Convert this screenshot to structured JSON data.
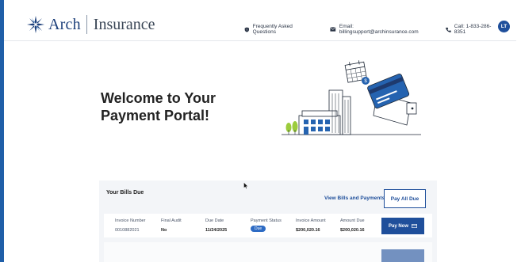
{
  "brand": {
    "name_left": "Arch",
    "name_right": "Insurance",
    "accent": "#1f4f9b"
  },
  "header": {
    "links": [
      {
        "icon": "question-shield-icon",
        "label": "Frequently Asked Questions"
      },
      {
        "icon": "mail-icon",
        "label": "Email: billingsupport@archinsurance.com"
      },
      {
        "icon": "phone-icon",
        "label": "Call: 1-833-286-8351"
      }
    ],
    "avatar_initials": "LT"
  },
  "welcome": {
    "line1": "Welcome to Your",
    "line2": "Payment Portal!"
  },
  "bills": {
    "title": "Your Bills Due",
    "view_link": "View Bills and Payments",
    "pay_all": "Pay All Due",
    "columns": [
      "Invoice Number",
      "Final Audit",
      "Due Date",
      "Payment Status",
      "Invoice Amount",
      "Amount Due"
    ],
    "rows": [
      {
        "invoice_number": "0010882021",
        "final_audit": "No",
        "due_date": "11/24/2025",
        "status": "Due",
        "invoice_amount": "$200,020.16",
        "amount_due": "$200,020.16",
        "action": "Pay Now"
      }
    ]
  }
}
